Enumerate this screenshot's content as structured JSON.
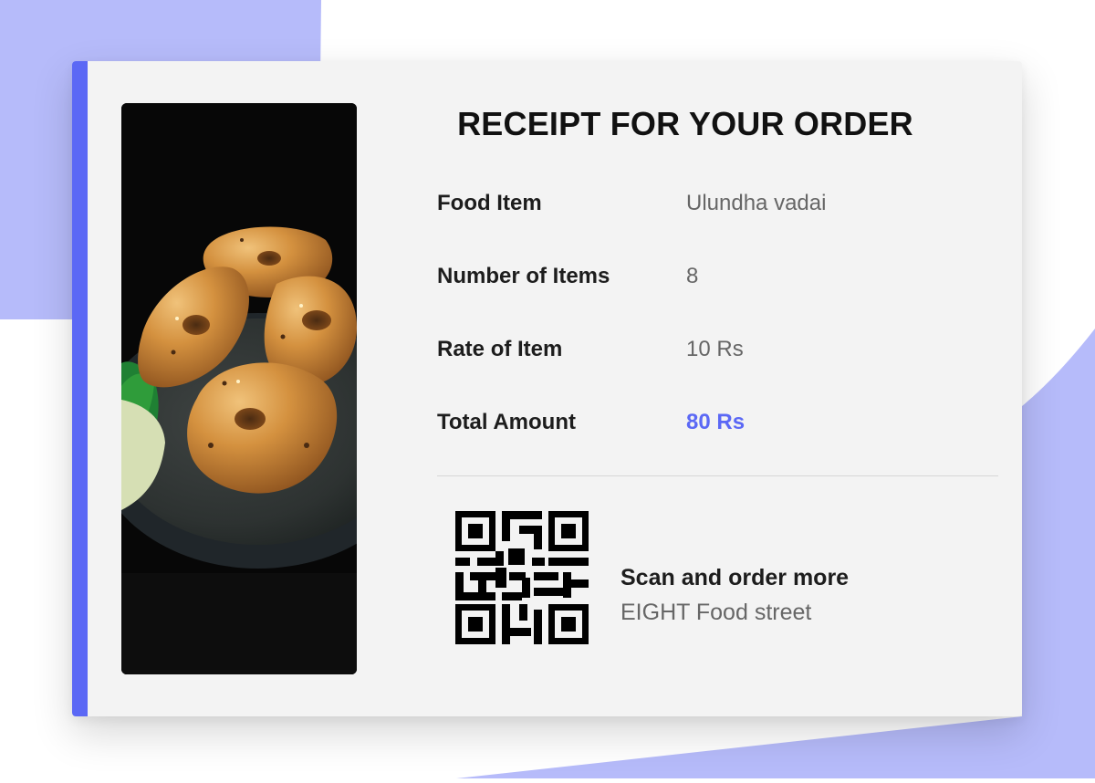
{
  "colors": {
    "accent": "#5b68f5",
    "background_shape": "#b6bbfa",
    "card_background": "#f3f3f3"
  },
  "photo": {
    "subject": "Ulundha vadai on a dark plate",
    "icon": "food-photo"
  },
  "receipt": {
    "title": "RECEIPT FOR YOUR ORDER",
    "rows": [
      {
        "label": "Food Item",
        "value": "Ulundha vadai"
      },
      {
        "label": "Number of Items",
        "value": "8"
      },
      {
        "label": "Rate of Item",
        "value": "10 Rs"
      },
      {
        "label": "Total Amount",
        "value": "80 Rs"
      }
    ]
  },
  "footer": {
    "qr_icon": "qr-code-icon",
    "scan_title": "Scan and order more",
    "scan_subtitle": "EIGHT Food street"
  }
}
